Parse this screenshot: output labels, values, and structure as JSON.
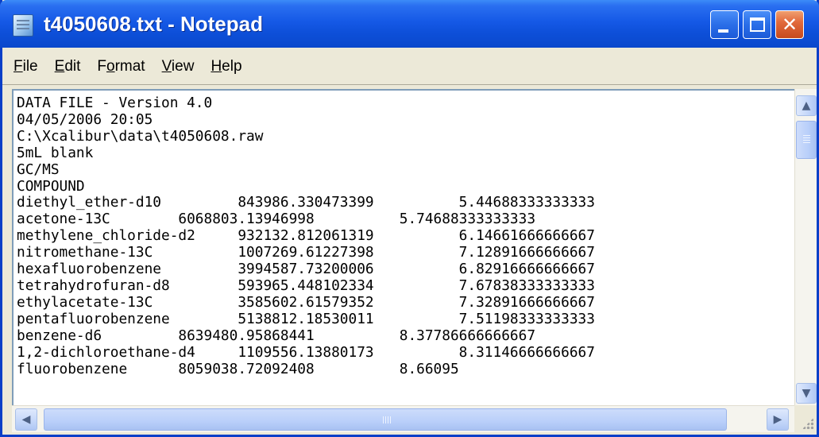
{
  "window": {
    "title": "t4050608.txt - Notepad",
    "icon": "notepad-icon",
    "controls": {
      "minimize_icon": "minimize-icon",
      "maximize_icon": "maximize-icon",
      "close_icon": "close-icon",
      "close_glyph": "✕"
    }
  },
  "menu": [
    {
      "accel": "F",
      "rest": "ile"
    },
    {
      "accel": "E",
      "rest": "dit"
    },
    {
      "pre": "F",
      "accel": "o",
      "rest": "rmat"
    },
    {
      "accel": "V",
      "rest": "iew"
    },
    {
      "accel": "H",
      "rest": "elp"
    }
  ],
  "document": {
    "lines": [
      "DATA FILE - Version 4.0",
      "04/05/2006 20:05",
      "C:\\Xcalibur\\data\\t4050608.raw",
      "5mL blank",
      "GC/MS",
      "COMPOUND",
      "diethyl_ether-d10         843986.330473399          5.44688333333333",
      "acetone-13C        6068803.13946998          5.74688333333333",
      "methylene_chloride-d2     932132.812061319          6.14661666666667",
      "nitromethane-13C          1007269.61227398          7.12891666666667",
      "hexafluorobenzene         3994587.73200006          6.82916666666667",
      "tetrahydrofuran-d8        593965.448102334          7.67838333333333",
      "ethylacetate-13C          3585602.61579352          7.32891666666667",
      "pentafluorobenzene        5138812.18530011          7.51198333333333",
      "benzene-d6         8639480.95868441          8.37786666666667",
      "1,2-dichloroethane-d4     1109556.13880173          8.31146666666667",
      "fluorobenzene      8059038.72092408          8.66095"
    ]
  },
  "scrollbars": {
    "up_arrow": "▲",
    "down_arrow": "▼",
    "left_arrow": "◀",
    "right_arrow": "▶"
  }
}
